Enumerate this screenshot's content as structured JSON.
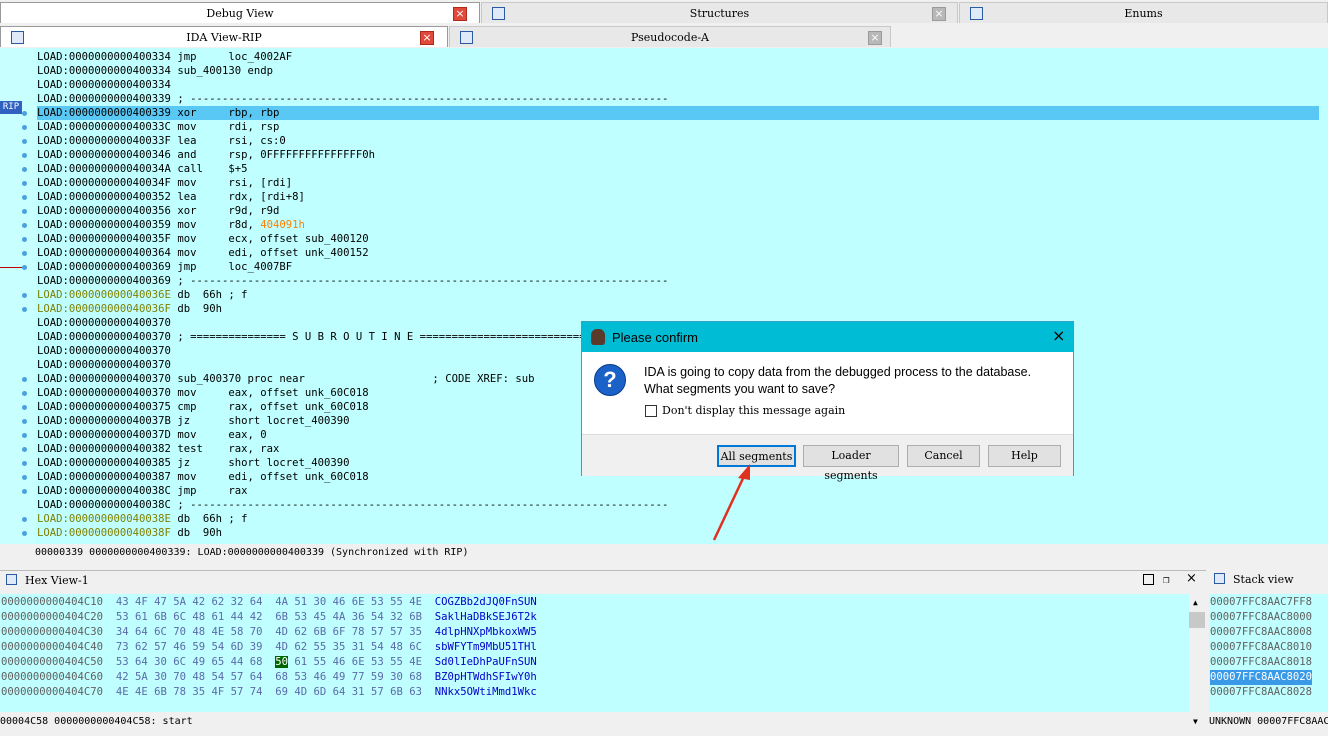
{
  "tabs_top": [
    {
      "label": "Debug View"
    },
    {
      "label": "Structures"
    },
    {
      "label": "Enums"
    }
  ],
  "tabs_second": [
    {
      "label": "IDA View-RIP"
    },
    {
      "label": "Pseudocode-A"
    }
  ],
  "rip_label": "RIP",
  "code_lines": [
    {
      "addr": "LOAD:0000000000400334",
      "code": " jmp     loc_4002AF",
      "style": "black"
    },
    {
      "addr": "LOAD:0000000000400334",
      "code": " sub_400130 endp",
      "style": "black"
    },
    {
      "addr": "LOAD:0000000000400334",
      "code": "",
      "style": "black"
    },
    {
      "addr": "LOAD:0000000000400339",
      "code": " ; ---------------------------------------------------------------------------",
      "style": "black"
    },
    {
      "addr": "LOAD:0000000000400339",
      "code": " xor     rbp, rbp",
      "style": "hl"
    },
    {
      "addr": "LOAD:000000000040033C",
      "code": " mov     rdi, rsp",
      "style": "black"
    },
    {
      "addr": "LOAD:000000000040033F",
      "code": " lea     rsi, cs:0",
      "style": "black"
    },
    {
      "addr": "LOAD:0000000000400346",
      "code": " and     rsp, 0FFFFFFFFFFFFFFF0h",
      "style": "black"
    },
    {
      "addr": "LOAD:000000000040034A",
      "code": " call    $+5",
      "style": "black"
    },
    {
      "addr": "LOAD:000000000040034F",
      "code": " mov     rsi, [rdi]",
      "style": "black"
    },
    {
      "addr": "LOAD:0000000000400352",
      "code": " lea     rdx, [rdi+8]",
      "style": "black"
    },
    {
      "addr": "LOAD:0000000000400356",
      "code": " xor     r9d, r9d",
      "style": "black"
    },
    {
      "addr": "LOAD:0000000000400359",
      "code": " mov     r8d, 404091h",
      "style": "black"
    },
    {
      "addr": "LOAD:000000000040035F",
      "code": " mov     ecx, offset sub_400120",
      "style": "black"
    },
    {
      "addr": "LOAD:0000000000400364",
      "code": " mov     edi, offset unk_400152",
      "style": "black"
    },
    {
      "addr": "LOAD:0000000000400369",
      "code": " jmp     loc_4007BF",
      "style": "black"
    },
    {
      "addr": "LOAD:0000000000400369",
      "code": " ; ---------------------------------------------------------------------------",
      "style": "black"
    },
    {
      "addr": "LOAD:000000000040036E",
      "code": " db  66h ; f",
      "style": "olive"
    },
    {
      "addr": "LOAD:000000000040036F",
      "code": " db  90h",
      "style": "olive"
    },
    {
      "addr": "LOAD:0000000000400370",
      "code": "",
      "style": "black"
    },
    {
      "addr": "LOAD:0000000000400370",
      "code": " ; =============== S U B R O U T I N E =======================================",
      "style": "black"
    },
    {
      "addr": "LOAD:0000000000400370",
      "code": "",
      "style": "black"
    },
    {
      "addr": "LOAD:0000000000400370",
      "code": "",
      "style": "black"
    },
    {
      "addr": "LOAD:0000000000400370",
      "code": " sub_400370 proc near                    ; CODE XREF: sub",
      "style": "black"
    },
    {
      "addr": "LOAD:0000000000400370",
      "code": " mov     eax, offset unk_60C018",
      "style": "black"
    },
    {
      "addr": "LOAD:0000000000400375",
      "code": " cmp     rax, offset unk_60C018",
      "style": "black"
    },
    {
      "addr": "LOAD:000000000040037B",
      "code": " jz      short locret_400390",
      "style": "black"
    },
    {
      "addr": "LOAD:000000000040037D",
      "code": " mov     eax, 0",
      "style": "black"
    },
    {
      "addr": "LOAD:0000000000400382",
      "code": " test    rax, rax",
      "style": "black"
    },
    {
      "addr": "LOAD:0000000000400385",
      "code": " jz      short locret_400390",
      "style": "black"
    },
    {
      "addr": "LOAD:0000000000400387",
      "code": " mov     edi, offset unk_60C018",
      "style": "black"
    },
    {
      "addr": "LOAD:000000000040038C",
      "code": " jmp     rax",
      "style": "black"
    },
    {
      "addr": "LOAD:000000000040038C",
      "code": " ; ---------------------------------------------------------------------------",
      "style": "black"
    },
    {
      "addr": "LOAD:000000000040038E",
      "code": " db  66h ; f",
      "style": "olive"
    },
    {
      "addr": "LOAD:000000000040038F",
      "code": " db  90h",
      "style": "olive"
    }
  ],
  "ida_status": "00000339 0000000000400339: LOAD:0000000000400339 (Synchronized with RIP)",
  "dialog": {
    "title": "Please confirm",
    "message_line1": "IDA is going to copy data from the debugged process to the database.",
    "message_line2": "What segments you want to save?",
    "checkbox_label": "Don't display this message again",
    "buttons": [
      "All segments",
      "Loader segments",
      "Cancel",
      "Help"
    ]
  },
  "hex_view": {
    "title": "Hex View-1",
    "rows": [
      {
        "addr": "0000000000404C10",
        "b1": "43 4F 47 5A 42 62 32 64",
        "b2": "4A 51 30 46 6E 53 55 4E",
        "ascii": "COGZBb2dJQ0FnSUN"
      },
      {
        "addr": "0000000000404C20",
        "b1": "53 61 6B 6C 48 61 44 42",
        "b2": "6B 53 45 4A 36 54 32 6B",
        "ascii": "SaklHaDBkSEJ6T2k"
      },
      {
        "addr": "0000000000404C30",
        "b1": "34 64 6C 70 48 4E 58 70",
        "b2": "4D 62 6B 6F 78 57 57 35",
        "ascii": "4dlpHNXpMbkoxWW5"
      },
      {
        "addr": "0000000000404C40",
        "b1": "73 62 57 46 59 54 6D 39",
        "b2": "4D 62 55 35 31 54 48 6C",
        "ascii": "sbWFYTm9MbU51THl"
      },
      {
        "addr": "0000000000404C50",
        "b1": "53 64 30 6C 49 65 44 68",
        "b2": "50 61 55 46 6E 53 55 4E",
        "ascii": "Sd0lIeDhPaUFnSUN",
        "sel": "50"
      },
      {
        "addr": "0000000000404C60",
        "b1": "42 5A 30 70 48 54 57 64",
        "b2": "68 53 46 49 77 59 30 68",
        "ascii": "BZ0pHTWdhSFIwY0h"
      },
      {
        "addr": "0000000000404C70",
        "b1": "4E 4E 6B 78 35 4F 57 74",
        "b2": "69 4D 6D 64 31 57 6B 63",
        "ascii": "NNkx5OWtiMmd1Wkc"
      }
    ],
    "status": "00004C58 0000000000404C58: start"
  },
  "stack_view": {
    "title": "Stack view",
    "rows": [
      "00007FFC8AAC7FF8",
      "00007FFC8AAC8000",
      "00007FFC8AAC8008",
      "00007FFC8AAC8010",
      "00007FFC8AAC8018",
      "00007FFC8AAC8020",
      "00007FFC8AAC8028"
    ],
    "selected_index": 5,
    "status": "UNKNOWN 00007FFC8AAC"
  }
}
